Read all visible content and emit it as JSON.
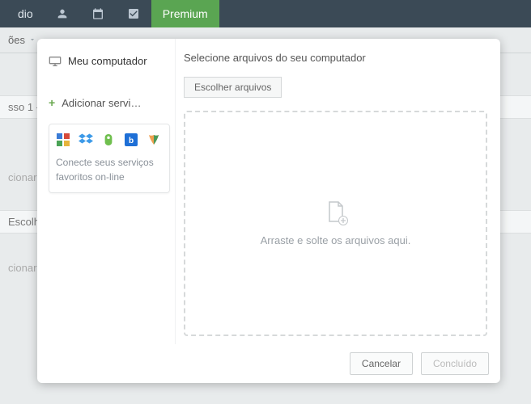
{
  "topbar": {
    "brand_suffix": "dio",
    "premium": "Premium"
  },
  "subbar": {
    "label": "ões"
  },
  "bg": {
    "step": "sso 1 - ",
    "add1": "cionar t",
    "choose": "Escolha",
    "add2": "cionar t"
  },
  "sidebar": {
    "computer": "Meu computador",
    "add_service": "Adicionar servi…",
    "services_text": "Conecte seus serviços favoritos on-line"
  },
  "main": {
    "title": "Selecione arquivos do seu computador",
    "choose_button": "Escolher arquivos",
    "dropzone_text": "Arraste e solte os arquivos aqui."
  },
  "footer": {
    "cancel": "Cancelar",
    "done": "Concluído"
  },
  "svc_icons": {
    "google": "google-icon",
    "dropbox": "dropbox-icon",
    "evernote": "evernote-icon",
    "box": "box-icon",
    "sharefile": "sharefile-icon"
  }
}
